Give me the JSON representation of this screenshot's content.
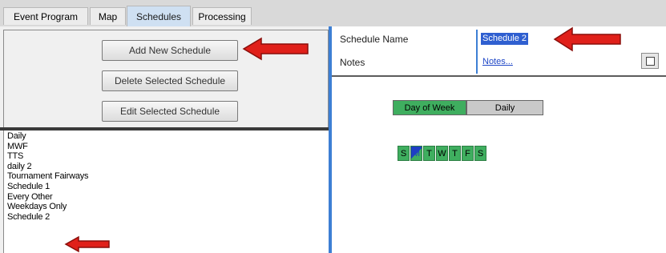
{
  "tabs": [
    {
      "label": "Event Program"
    },
    {
      "label": "Map"
    },
    {
      "label": "Schedules"
    },
    {
      "label": "Processing"
    }
  ],
  "buttons": {
    "add": "Add New Schedule",
    "delete": "Delete Selected Schedule",
    "edit": "Edit Selected Schedule"
  },
  "schedules": [
    "Daily",
    "MWF",
    "TTS",
    "daily 2",
    "Tournament Fairways",
    "Schedule 1",
    "Every Other",
    "Weekdays Only",
    "Schedule 2"
  ],
  "properties": {
    "name_label": "Schedule Name",
    "name_value": "Schedule 2",
    "notes_label": "Notes",
    "notes_value": "Notes..."
  },
  "mode_toggle": {
    "day_of_week": "Day of Week",
    "daily": "Daily",
    "selected": "Day of Week"
  },
  "days": [
    "S",
    "M",
    "T",
    "W",
    "T",
    "F",
    "S"
  ],
  "colors": {
    "accent": "#3d7fd4",
    "selected_green": "#3fae5f",
    "arrow": "#e0201a"
  }
}
